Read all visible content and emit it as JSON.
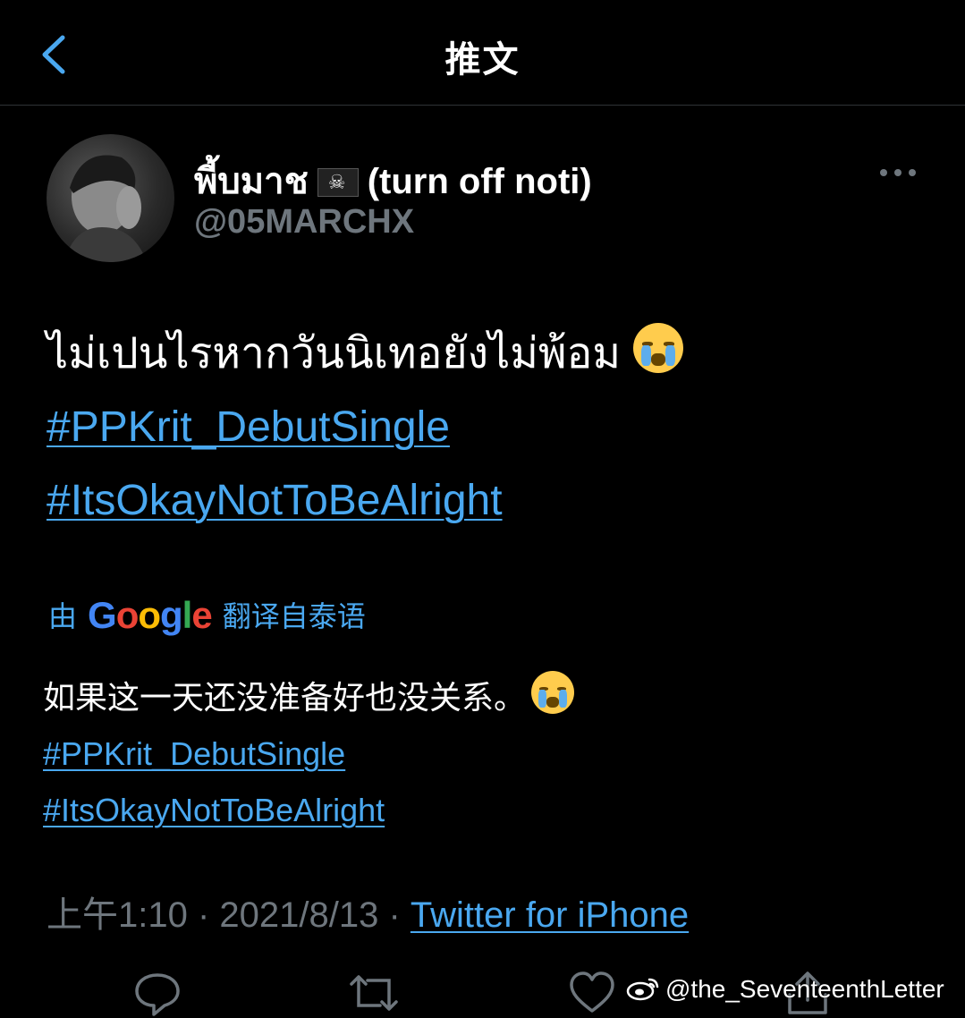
{
  "header": {
    "title": "推文"
  },
  "author": {
    "display_name_thai": "พี้บมาช",
    "flag_glyph": "☠",
    "display_name_suffix": "(turn off noti)",
    "handle": "@05MARCHX"
  },
  "tweet": {
    "text": "ไม่เปนไรหากวันนิเทอยังไม่พ้อม",
    "hashtags": [
      "#PPKrit_DebutSingle",
      "#ItsOkayNotToBeAlright"
    ]
  },
  "translation": {
    "prefix": "由",
    "google": {
      "G": "G",
      "o1": "o",
      "o2": "o",
      "g": "g",
      "l": "l",
      "e": "e"
    },
    "suffix": "翻译自泰语",
    "text": "如果这一天还没准备好也没关系。",
    "hashtags": [
      "#PPKrit_DebutSingle",
      "#ItsOkayNotToBeAlright"
    ]
  },
  "meta": {
    "time": "上午1:10",
    "separator": " · ",
    "date": "2021/8/13",
    "source": "Twitter for iPhone"
  },
  "watermark": "@the_SeventeenthLetter",
  "colors": {
    "background": "#000000",
    "link": "#4aa8f0",
    "muted": "#6e767d"
  }
}
